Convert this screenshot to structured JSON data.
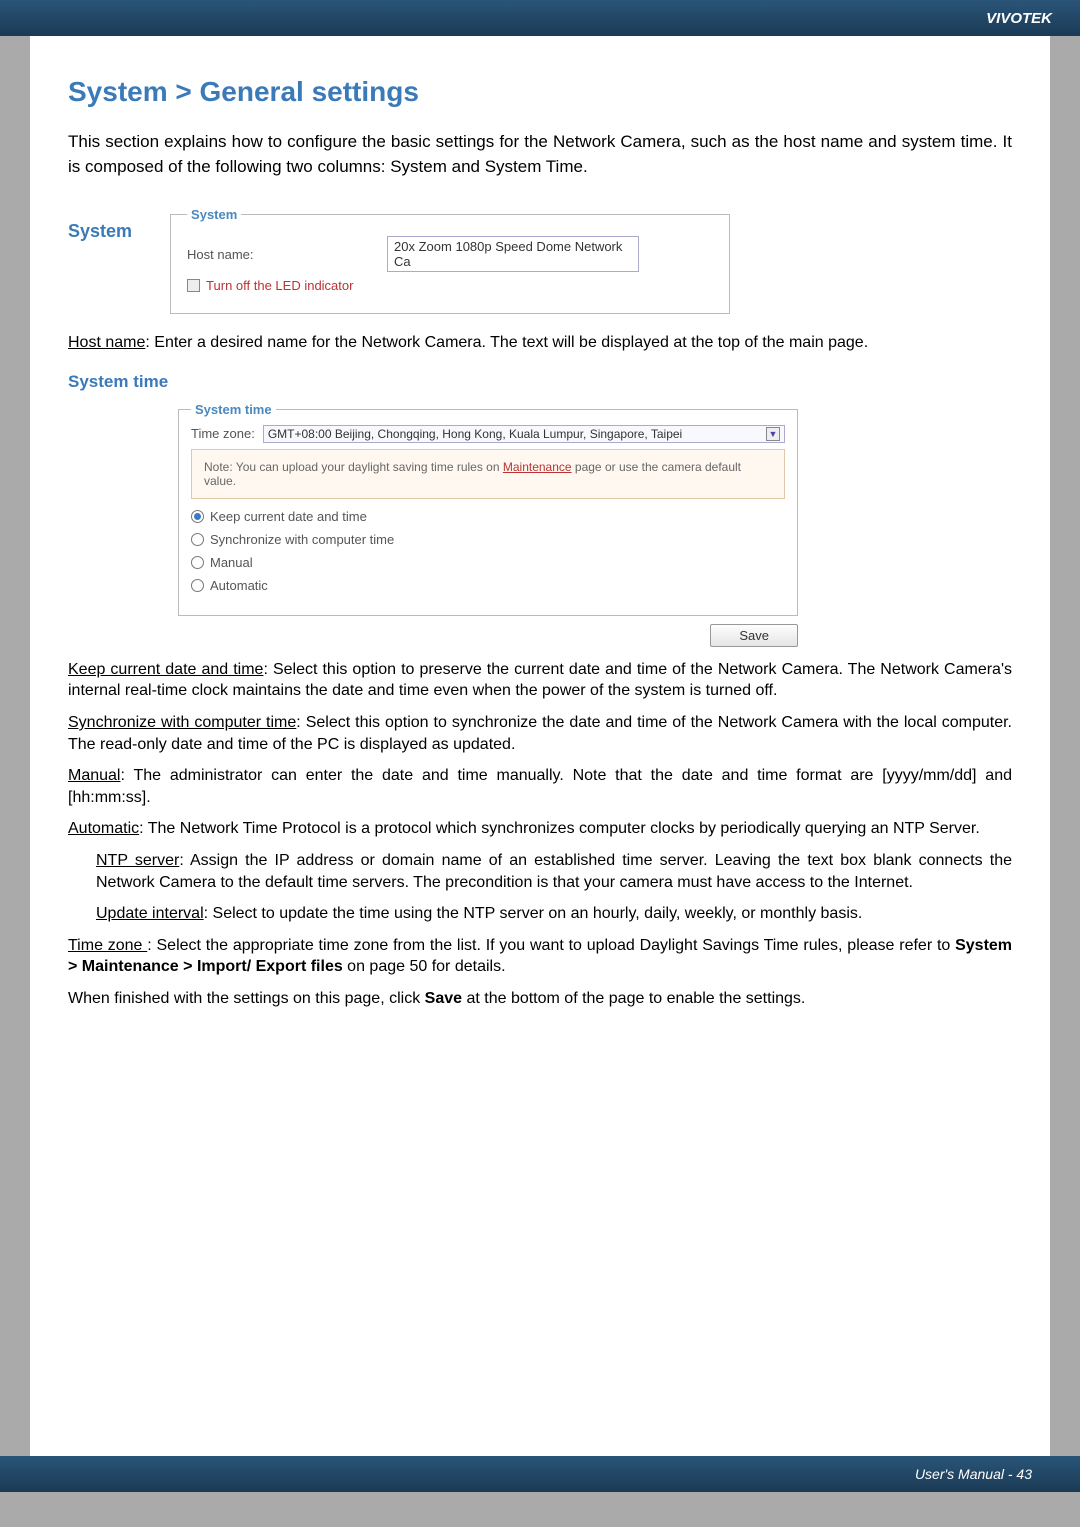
{
  "header": {
    "brand": "VIVOTEK"
  },
  "page_title": "System > General settings",
  "intro": "This section explains how to configure the basic settings for the Network Camera, such as the host name and system time. It is composed of the following two columns: System and System Time.",
  "system": {
    "side_label": "System",
    "legend": "System",
    "host_name_label": "Host name:",
    "host_name_value": "20x Zoom 1080p Speed Dome Network Ca",
    "led_label": "Turn off the LED indicator"
  },
  "host_name_desc_pre": "Host name",
  "host_name_desc_rest": ": Enter a desired name for the Network Camera. The text will be displayed at the top of the main page.",
  "system_time": {
    "heading": "System time",
    "legend": "System time",
    "tz_label": "Time zone:",
    "tz_value": "GMT+08:00 Beijing, Chongqing, Hong Kong, Kuala Lumpur, Singapore, Taipei",
    "note_pre": "Note: You can upload your daylight saving time rules on ",
    "note_link": "Maintenance",
    "note_post": " page or use the camera default value.",
    "opts": {
      "keep": "Keep current date and time",
      "sync": "Synchronize with computer time",
      "manual": "Manual",
      "auto": "Automatic"
    },
    "save": "Save"
  },
  "paras": {
    "keep_u": "Keep current date and time",
    "keep_t": ": Select this option to preserve the current date and time of the Network Camera. The Network Camera's internal real-time clock maintains the date and time even when the power of the system is turned off.",
    "sync_u": "Synchronize with computer time",
    "sync_t": ": Select this option to synchronize the date and time of the Network Camera with the local computer. The read-only date and time of the PC is displayed as updated.",
    "manual_u": "Manual",
    "manual_t": ": The administrator can enter the date and time manually. Note that the date and time format are [yyyy/mm/dd] and [hh:mm:ss].",
    "auto_u": "Automatic",
    "auto_t": ": The Network Time Protocol is a protocol which synchronizes computer clocks by periodically querying an NTP Server.",
    "ntp_u": "NTP server",
    "ntp_t": ": Assign the IP address or domain name of an established time server. Leaving the text box blank connects the Network Camera to the default time servers. The precondition is that your camera must have access to the Internet.",
    "upd_u": "Update interval",
    "upd_t": ": Select to update the time using the NTP server on an hourly, daily, weekly, or monthly basis.",
    "tz_u": "Time zone ",
    "tz_t1": ": Select the appropriate time zone from the list. If you want to upload Daylight Savings Time rules, please refer to ",
    "tz_b": "System > Maintenance > Import/ Export files",
    "tz_t2": " on page 50 for details.",
    "fin1": "When finished with the settings on this page, click ",
    "fin_b": "Save",
    "fin2": " at the bottom of the page to enable the settings."
  },
  "footer": {
    "text": "User's Manual - 43"
  }
}
